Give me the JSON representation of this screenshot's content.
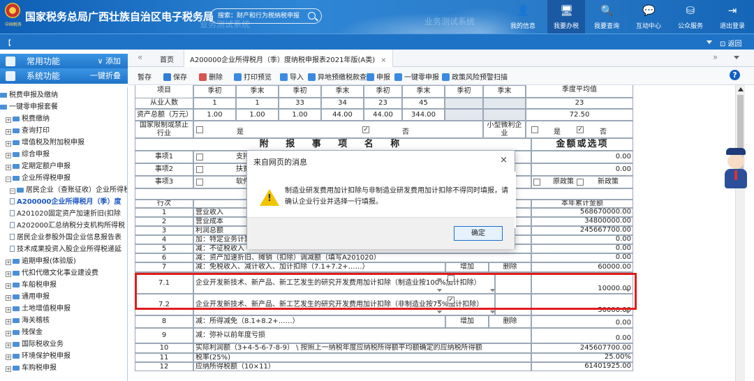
{
  "header": {
    "title": "国家税务总局广西壮族自治区电子税务局",
    "logo_text": "中国税务",
    "watermark": "业务测试系统",
    "search_placeholder": "搜索：财产和行为税纳税申报",
    "nav": [
      {
        "label": "我的信息",
        "icon": "user-icon"
      },
      {
        "label": "我要办税",
        "icon": "monitor-icon",
        "active": true
      },
      {
        "label": "我要查询",
        "icon": "query-icon"
      },
      {
        "label": "互动中心",
        "icon": "chat-icon"
      },
      {
        "label": "公众服务",
        "icon": "public-service-icon"
      },
      {
        "label": "退出登录",
        "icon": "logout-icon"
      }
    ]
  },
  "subbar": {
    "bracket": "【",
    "return": "返回"
  },
  "sidebar": {
    "common": {
      "label": "常用功能",
      "action": "添加"
    },
    "system": {
      "label": "系统功能",
      "action": "一键折叠"
    },
    "items": [
      {
        "text": "税费申报及缴纳",
        "type": "root"
      },
      {
        "text": "一键零申报套餐",
        "type": "root"
      },
      {
        "text": "税费缴纳",
        "type": "folder"
      },
      {
        "text": "查询打印",
        "type": "folder"
      },
      {
        "text": "增值税及附加税申报",
        "type": "folder"
      },
      {
        "text": "综合申报",
        "type": "folder"
      },
      {
        "text": "定期定额户申报",
        "type": "folder"
      },
      {
        "text": "企业所得税申报",
        "type": "folder-open"
      },
      {
        "text": "居民企业（查账征收）企业所得税",
        "type": "folder-open"
      },
      {
        "text": "A200000企业所得税月（季）度",
        "type": "selected"
      },
      {
        "text": "A201020固定资产加速折旧(扣除",
        "type": "doc"
      },
      {
        "text": "A202000汇总纳税分支机构所得税",
        "type": "doc"
      },
      {
        "text": "居民企业参股外国企业信息报告表",
        "type": "doc"
      },
      {
        "text": "技术成果投资入股企业所得税递延",
        "type": "doc"
      },
      {
        "text": "逾期申报(体验版)",
        "type": "folder"
      },
      {
        "text": "代扣代缴文化事业建设费",
        "type": "folder"
      },
      {
        "text": "车船税申报",
        "type": "folder"
      },
      {
        "text": "通用申报",
        "type": "folder"
      },
      {
        "text": "土地增值税申报",
        "type": "folder"
      },
      {
        "text": "海关稽核",
        "type": "folder"
      },
      {
        "text": "残保金",
        "type": "folder"
      },
      {
        "text": "国际税收业务",
        "type": "folder"
      },
      {
        "text": "环境保护税申报",
        "type": "folder"
      },
      {
        "text": "车购税申报",
        "type": "folder"
      }
    ]
  },
  "tabs": {
    "prev": "«",
    "next": "»",
    "home": "首页",
    "active": "A200000企业所得税月（季）度纳税申报表2021年版(A类)",
    "close": "×"
  },
  "toolbar": [
    {
      "label": "暂存",
      "color": ""
    },
    {
      "label": "保存",
      "color": "#2f7fd8"
    },
    {
      "label": "删除",
      "color": "#d9534f"
    },
    {
      "label": "打印预览",
      "color": "#3a8be0"
    },
    {
      "label": "导入",
      "color": "#3a8be0"
    },
    {
      "label": "异地预缴税款查询",
      "color": "#3a8be0"
    },
    {
      "label": "申报",
      "color": "#3a8be0"
    },
    {
      "label": "一键零申报",
      "color": "#3a8be0"
    },
    {
      "label": "政策风险预警扫描",
      "color": "#3a8be0"
    }
  ],
  "help": "?",
  "form": {
    "top_header_item": "项目",
    "top_header_avg": "季度平均值",
    "period_headers": [
      "季初",
      "季末",
      "季初",
      "季末",
      "季初",
      "季末",
      "季初",
      "季末"
    ],
    "employees": {
      "label": "从业人数",
      "values": [
        "1",
        "1",
        "33",
        "34",
        "23",
        "45",
        "",
        ""
      ],
      "avg": "23"
    },
    "assets": {
      "label": "资产总额（万元）",
      "values": [
        "1.00",
        "1.00",
        "1.00",
        "44.00",
        "44.00",
        "344.00",
        "",
        ""
      ],
      "avg": "72.50"
    },
    "restrict": {
      "label": "国家限制或禁止行业",
      "yes": "是",
      "no": "否",
      "small_label": "小型微利企业"
    },
    "addendum": {
      "title": "附 报 事 项 名 称",
      "amount_title": "金额或选项",
      "items": [
        {
          "label": "事项1",
          "name": "支持…",
          "value": "0.00"
        },
        {
          "label": "事项2",
          "name": "扶贫…",
          "value": "0.00"
        },
        {
          "label": "事项3",
          "name": "软件…",
          "value": "",
          "opt1": "原政策",
          "opt2": "新政策"
        }
      ]
    },
    "rows_header": {
      "seq": "行次",
      "amount": "本年累计金额"
    },
    "rows": [
      {
        "seq": "1",
        "item": "营业收入",
        "value": "568670000.00"
      },
      {
        "seq": "2",
        "item": "营业成本",
        "value": "34800000.00"
      },
      {
        "seq": "3",
        "item": "利润总额",
        "value": "245667700.00"
      },
      {
        "seq": "4",
        "item": "加：特定业务计算…",
        "value": "0.00"
      },
      {
        "seq": "5",
        "item": "减：不征税收入",
        "value": "0.00"
      },
      {
        "seq": "6",
        "item": "减：资产加速折旧、摊销（扣除）调减额（填写A201020）",
        "value": "0.00"
      },
      {
        "seq": "7",
        "item": "减：免税收入、减计收入、加计扣除（7.1+7.2+……）",
        "add": "增加",
        "del": "删除",
        "value": "60000.00"
      },
      {
        "seq": "7.1",
        "item": "企业开发新技术、新产品、新工艺发生的研究开发费用加计扣除（制造业按100%加计扣除）",
        "value": "10000.00"
      },
      {
        "seq": "7.2",
        "item": "企业开发新技术、新产品、新工艺发生的研究开发费用加计扣除（非制造业按75%加计扣除）",
        "value": "50000.00"
      },
      {
        "seq": "8",
        "item": "减：所得减免（8.1+8.2+……）",
        "add": "增加",
        "del": "删除",
        "value": "0.00"
      },
      {
        "seq": "9",
        "item": "减：弥补以前年度亏损",
        "value": "0.00"
      },
      {
        "seq": "10",
        "item": "实际利润额（3+4-5-6-7-8-9） \\ 按照上一纳税年度应纳税所得额平均额确定的应纳税所得额",
        "value": "245607700.00"
      },
      {
        "seq": "11",
        "item": "税率(25%)",
        "value": "25.00%"
      },
      {
        "seq": "12",
        "item": "应纳所得税额（10×11）",
        "value": "61401925.00"
      }
    ]
  },
  "dialog": {
    "title": "来自网页的消息",
    "close": "×",
    "message": "制造业研发费用加计扣除与非制造业研发费用加计扣除不得同时填报，请确认企业行业并选择一行填报。",
    "ok": "确定"
  }
}
